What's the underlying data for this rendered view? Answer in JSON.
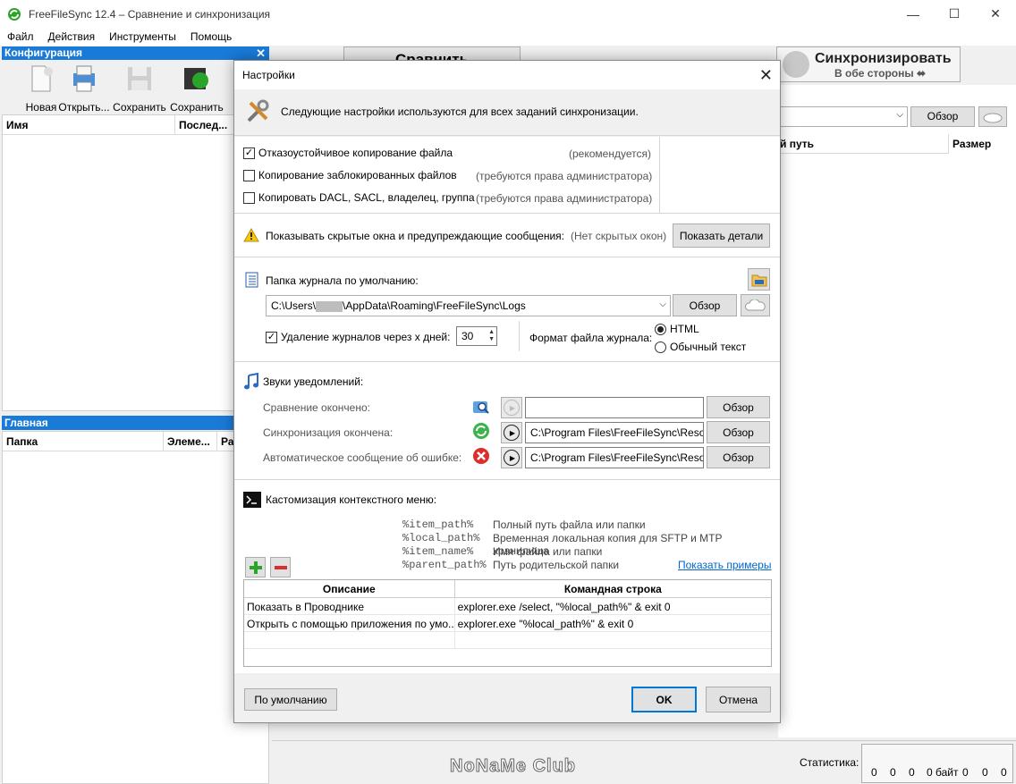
{
  "window": {
    "title": "FreeFileSync 12.4 – Сравнение и синхронизация",
    "minimize": "—",
    "maximize": "☐",
    "close": "✕"
  },
  "menu": [
    "Файл",
    "Действия",
    "Инструменты",
    "Помощь"
  ],
  "config_panel": {
    "header": "Конфигурация",
    "close": "✕",
    "tools": [
      "Новая",
      "Открыть...",
      "Сохранить",
      "Сохранить ка"
    ],
    "columns": [
      "Имя",
      "Послед..."
    ]
  },
  "main_panel": {
    "header": "Главная",
    "columns": [
      "Папка",
      "Элеме...",
      "Ра"
    ]
  },
  "toolbar": {
    "compare": "Сравнить",
    "sync_title": "Синхронизировать",
    "sync_sub": "В обе стороны ⬌"
  },
  "right_panel": {
    "browse": "Обзор",
    "col_path": "й путь",
    "col_size": "Размер"
  },
  "status": {
    "label": "Статистика:",
    "values": [
      "0",
      "0",
      "0",
      "0 байт",
      "0",
      "0",
      "0"
    ]
  },
  "watermark": "NoNaMe Club",
  "dialog": {
    "title": "Настройки",
    "close": "✕",
    "intro": "Следующие настройки используются для всех заданий синхронизации.",
    "copy_options": [
      {
        "label": "Отказоустойчивое копирование файла",
        "hint": "(рекомендуется)",
        "checked": true
      },
      {
        "label": "Копирование заблокированных файлов",
        "hint": "(требуются права администратора)",
        "checked": false
      },
      {
        "label": "Копировать DACL, SACL, владелец, группа",
        "hint": "(требуются права администратора)",
        "checked": false
      }
    ],
    "warnings": {
      "label": "Показывать скрытые окна и предупреждающие сообщения:",
      "status": "(Нет скрытых окон)",
      "button": "Показать детали"
    },
    "log": {
      "label": "Папка журнала по умолчанию:",
      "path_prefix": "C:\\Users\\",
      "path_suffix": "\\AppData\\Roaming\\FreeFileSync\\Logs",
      "browse": "Обзор",
      "delete_label": "Удаление журналов через х дней:",
      "delete_checked": true,
      "days": "30",
      "format_label": "Формат файла журнала:",
      "format_options": [
        "HTML",
        "Обычный текст"
      ],
      "format_selected": "HTML"
    },
    "sounds": {
      "label": "Звуки уведомлений:",
      "items": [
        {
          "label": "Сравнение окончено:",
          "path": "",
          "browse": "Обзор"
        },
        {
          "label": "Синхронизация окончена:",
          "path": "C:\\Program Files\\FreeFileSync\\Resou",
          "browse": "Обзор"
        },
        {
          "label": "Автоматическое сообщение об ошибке:",
          "path": "C:\\Program Files\\FreeFileSync\\Resou",
          "browse": "Обзор"
        }
      ]
    },
    "context_menu": {
      "label": "Кастомизация контекстного меню:",
      "macros": [
        {
          "name": "%item_path%",
          "desc": "Полный путь файла или папки"
        },
        {
          "name": "%local_path%",
          "desc": "Временная локальная копия для SFTP и MTP хранилища"
        },
        {
          "name": "%item_name%",
          "desc": "Имя файла или папки"
        },
        {
          "name": "%parent_path%",
          "desc": "Путь родительской папки"
        }
      ],
      "examples_link": "Показать примеры",
      "columns": [
        "Описание",
        "Командная строка"
      ],
      "rows": [
        [
          "Показать в Проводнике",
          "explorer.exe /select, \"%local_path%\" & exit 0"
        ],
        [
          "Открыть с помощью приложения по умо...",
          "explorer.exe \"%local_path%\" & exit 0"
        ]
      ]
    },
    "buttons": {
      "defaults": "По умолчанию",
      "ok": "OK",
      "cancel": "Отмена"
    }
  }
}
